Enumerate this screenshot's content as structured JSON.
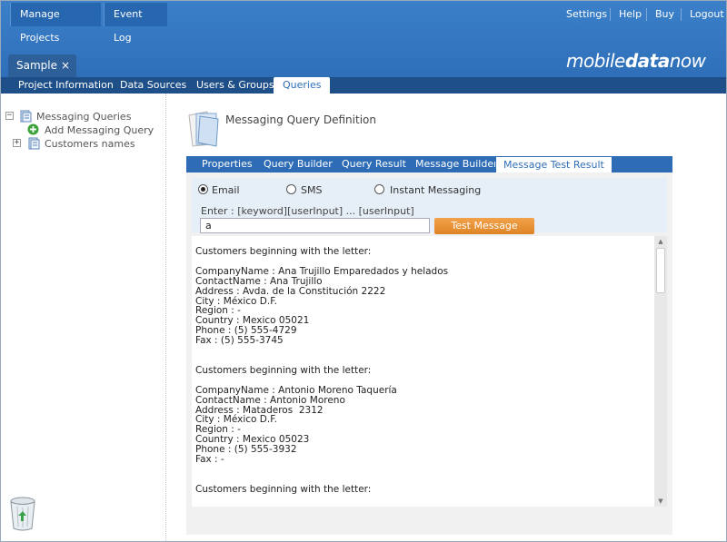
{
  "topnav": {
    "manage_projects": "Manage Projects",
    "event_log": "Event Log",
    "settings": "Settings",
    "help": "Help",
    "buy": "Buy",
    "logout": "Logout"
  },
  "project_tab": {
    "label": "Sample",
    "close": "×"
  },
  "logo": {
    "part1": "mobile",
    "part2": "data",
    "part3": "now"
  },
  "subnav": {
    "items": [
      "Project Information",
      "Data Sources",
      "Users & Groups",
      "Queries"
    ],
    "active": "Queries"
  },
  "tree": {
    "root_expander": "−",
    "root_label": "Messaging Queries",
    "add_label": "Add Messaging Query",
    "child_expander": "+",
    "child_label": "Customers names"
  },
  "main": {
    "title": "Messaging Query Definition",
    "tabs": [
      "Properties",
      "Query Builder",
      "Query Result",
      "Message Builder",
      "Message Test Result"
    ],
    "active_tab": "Message Test Result"
  },
  "form": {
    "channels": [
      "Email",
      "SMS",
      "Instant Messaging"
    ],
    "selected_channel": "Email",
    "enter_label": "Enter : [keyword][userInput] ... [userInput]",
    "input_value": "a",
    "test_button": "Test Message"
  },
  "result": {
    "text": "Customers beginning with the letter:\n\nCompanyName : Ana Trujillo Emparedados y helados\nContactName : Ana Trujillo\nAddress : Avda. de la Constitución 2222\nCity : México D.F.\nRegion : -\nCountry : Mexico 05021\nPhone : (5) 555-4729\nFax : (5) 555-3745\n\n\nCustomers beginning with the letter:\n\nCompanyName : Antonio Moreno Taquería\nContactName : Antonio Moreno\nAddress : Mataderos  2312\nCity : México D.F.\nRegion : -\nCountry : Mexico 05023\nPhone : (5) 555-3932\nFax : -\n\n\nCustomers beginning with the letter:"
  },
  "colors": {
    "header_blue": "#2f6fb9",
    "subnav_blue": "#1e4f88",
    "button_orange": "#e8912f"
  }
}
